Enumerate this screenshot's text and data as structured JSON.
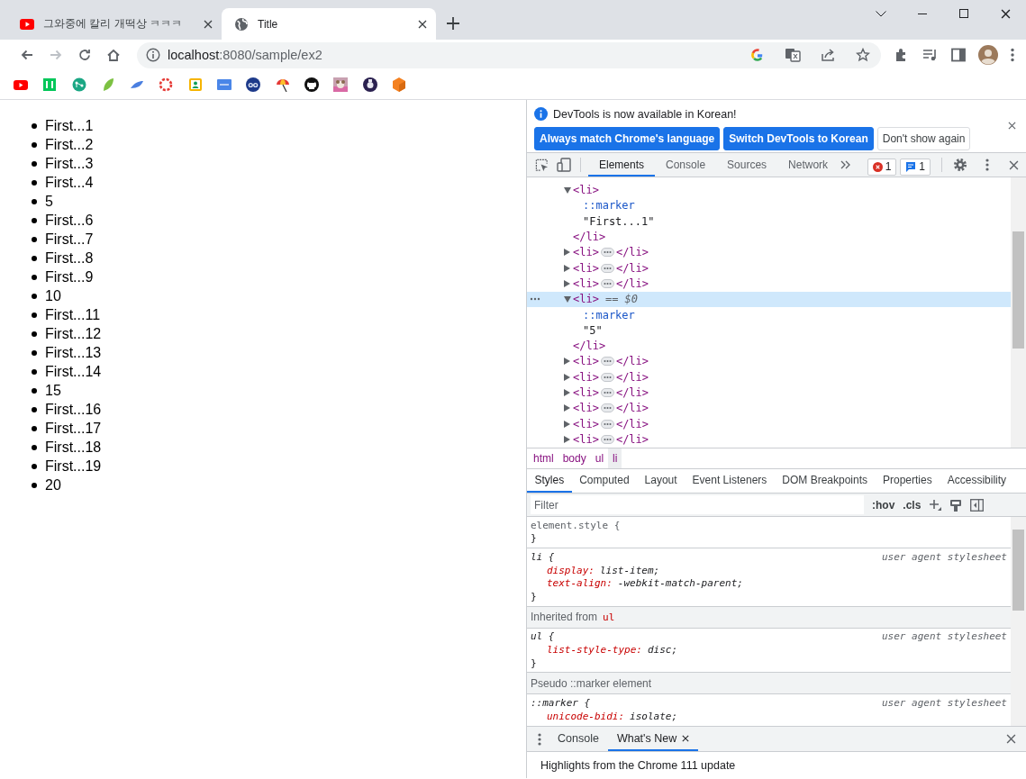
{
  "browser": {
    "tabs": [
      {
        "title": "그와중에 칼리 개떡상 ㅋㅋㅋ",
        "kind": "youtube",
        "selected": false
      },
      {
        "title": "Title",
        "kind": "globe",
        "selected": true
      }
    ],
    "nav": [
      {
        "kind": "back",
        "disabled": false
      },
      {
        "kind": "forward",
        "disabled": true
      },
      {
        "kind": "reload",
        "disabled": false
      },
      {
        "kind": "home",
        "disabled": false
      }
    ],
    "address": {
      "host": "localhost",
      "path": ":8080/sample/ex2"
    }
  },
  "page": {
    "items": [
      "First...1",
      "First...2",
      "First...3",
      "First...4",
      "5",
      "First...6",
      "First...7",
      "First...8",
      "First...9",
      "10",
      "First...11",
      "First...12",
      "First...13",
      "First...14",
      "15",
      "First...16",
      "First...17",
      "First...18",
      "First...19",
      "20"
    ]
  },
  "devtools": {
    "infobar": {
      "message": "DevTools is now available in Korean!",
      "buttons": [
        {
          "label": "Always match Chrome's language",
          "kind": "primary"
        },
        {
          "label": "Switch DevTools to Korean",
          "kind": "primary"
        },
        {
          "label": "Don't show again",
          "kind": "secondary"
        }
      ]
    },
    "panel_tabs": [
      {
        "label": "Elements",
        "selected": true
      },
      {
        "label": "Console",
        "selected": false
      },
      {
        "label": "Sources",
        "selected": false
      },
      {
        "label": "Network",
        "selected": false
      }
    ],
    "error_count": "1",
    "message_count": "1",
    "dom_tree": [
      {
        "kind": "element",
        "open": "<li>",
        "close": "</li>",
        "expanded": true,
        "selected": false,
        "children": [
          {
            "kind": "pseudo",
            "text": "::marker"
          },
          {
            "kind": "text",
            "text": "\"First...1\""
          }
        ]
      },
      {
        "kind": "element",
        "open": "<li>",
        "close": "</li>",
        "expanded": false,
        "selected": false
      },
      {
        "kind": "element",
        "open": "<li>",
        "close": "</li>",
        "expanded": false,
        "selected": false
      },
      {
        "kind": "element",
        "open": "<li>",
        "close": "</li>",
        "expanded": false,
        "selected": false
      },
      {
        "kind": "element",
        "open": "<li>",
        "close": "</li>",
        "note": "== $0",
        "expanded": true,
        "selected": true,
        "children": [
          {
            "kind": "pseudo",
            "text": "::marker"
          },
          {
            "kind": "text",
            "text": "\"5\""
          }
        ]
      },
      {
        "kind": "element",
        "open": "<li>",
        "close": "</li>",
        "expanded": false,
        "selected": false
      },
      {
        "kind": "element",
        "open": "<li>",
        "close": "</li>",
        "expanded": false,
        "selected": false
      },
      {
        "kind": "element",
        "open": "<li>",
        "close": "</li>",
        "expanded": false,
        "selected": false
      },
      {
        "kind": "element",
        "open": "<li>",
        "close": "</li>",
        "expanded": false,
        "selected": false
      },
      {
        "kind": "element",
        "open": "<li>",
        "close": "</li>",
        "expanded": false,
        "selected": false
      },
      {
        "kind": "element",
        "open": "<li>",
        "close": "</li>",
        "expanded": false,
        "selected": false
      }
    ],
    "breadcrumbs": [
      {
        "label": "html",
        "selected": false
      },
      {
        "label": "body",
        "selected": false
      },
      {
        "label": "ul",
        "selected": false
      },
      {
        "label": "li",
        "selected": true
      }
    ],
    "styles_tabs": [
      {
        "label": "Styles",
        "selected": true
      },
      {
        "label": "Computed",
        "selected": false
      },
      {
        "label": "Layout",
        "selected": false
      },
      {
        "label": "Event Listeners",
        "selected": false
      },
      {
        "label": "DOM Breakpoints",
        "selected": false
      },
      {
        "label": "Properties",
        "selected": false
      },
      {
        "label": "Accessibility",
        "selected": false
      }
    ],
    "filter": {
      "placeholder": "Filter"
    },
    "filter_buttons": [
      ":hov",
      ".cls"
    ],
    "rules": [
      {
        "kind": "rule",
        "selector": "element.style {",
        "close": "}"
      },
      {
        "kind": "rule",
        "selector": "li {",
        "source": "user agent stylesheet",
        "declarations": [
          {
            "property": "display:",
            "value": "list-item;"
          },
          {
            "property": "text-align:",
            "value": "-webkit-match-parent;"
          }
        ],
        "close": "}"
      },
      {
        "kind": "header",
        "text": "Inherited from",
        "tag": "ul"
      },
      {
        "kind": "rule",
        "selector": "ul {",
        "source": "user agent stylesheet",
        "declarations": [
          {
            "property": "list-style-type:",
            "value": "disc;"
          }
        ],
        "close": "}"
      },
      {
        "kind": "header",
        "text": "Pseudo ::marker element"
      },
      {
        "kind": "rule",
        "selector": "::marker {",
        "source": "user agent stylesheet",
        "declarations": [
          {
            "property": "unicode-bidi:",
            "value": "isolate;"
          }
        ]
      }
    ],
    "drawer": {
      "tabs": [
        {
          "label": "Console",
          "closable": false,
          "selected": false
        },
        {
          "label": "What's New",
          "closable": true,
          "selected": true
        }
      ],
      "content": "Highlights from the Chrome 111 update"
    }
  }
}
